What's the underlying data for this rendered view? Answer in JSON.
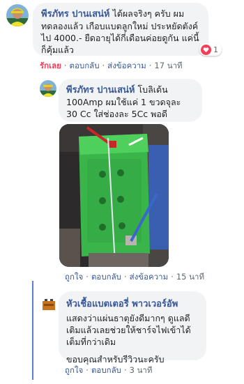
{
  "comment1": {
    "author": "พีรภัทร ปานเสน่ห์",
    "text": " ได้ผลจริงๆ ครับ ผมทดลองแล้ว เกือบแบตลูกใหม่ ประหยัดตังค์ไป 4000.- ยืดอายุได้กี่เดือนค่อยดูกัน แค่นี้ก็คุ้มแล้ว",
    "reaction_count": "1",
    "reaction_icon": "heart-icon",
    "actions": {
      "love": "รักเลย",
      "reply": "ตอบกลับ",
      "message": "ส่งข้อความ",
      "time": "17 นาที"
    }
  },
  "comment2": {
    "author": "พีรภัทร ปานเสน่ห์",
    "text": " โบลิเด้น 100Amp ผมใช้แค่ 1 ขวดจุละ 30 Cc ใส่ช่องละ 5Cc พอดี",
    "actions": {
      "like": "ถูกใจ",
      "reply": "ตอบกลับ",
      "message": "ส่งข้อความ",
      "time": "15 นาที"
    }
  },
  "reply": {
    "author": "หัวเชื้อแบตเตอรี่ พาวเวอร์อัพ",
    "text": "แสดงว่าแผ่นธาตุยังดีมากๆ ดูแลดีเติมแล้วเลยช่วยให้ชาร์จไฟเข้าได้เต็มที่กว่าเดิม",
    "text2": "ขอบคุณสำหรับรีวิวนะครับ",
    "actions": {
      "like": "ถูกใจ",
      "reply": "ตอบกลับ",
      "time": "3 นาที"
    }
  },
  "colors": {
    "link": "#385898",
    "love": "#f33e58",
    "bubble": "#f2f3f5",
    "reply_bar": "#5b7bd5"
  }
}
